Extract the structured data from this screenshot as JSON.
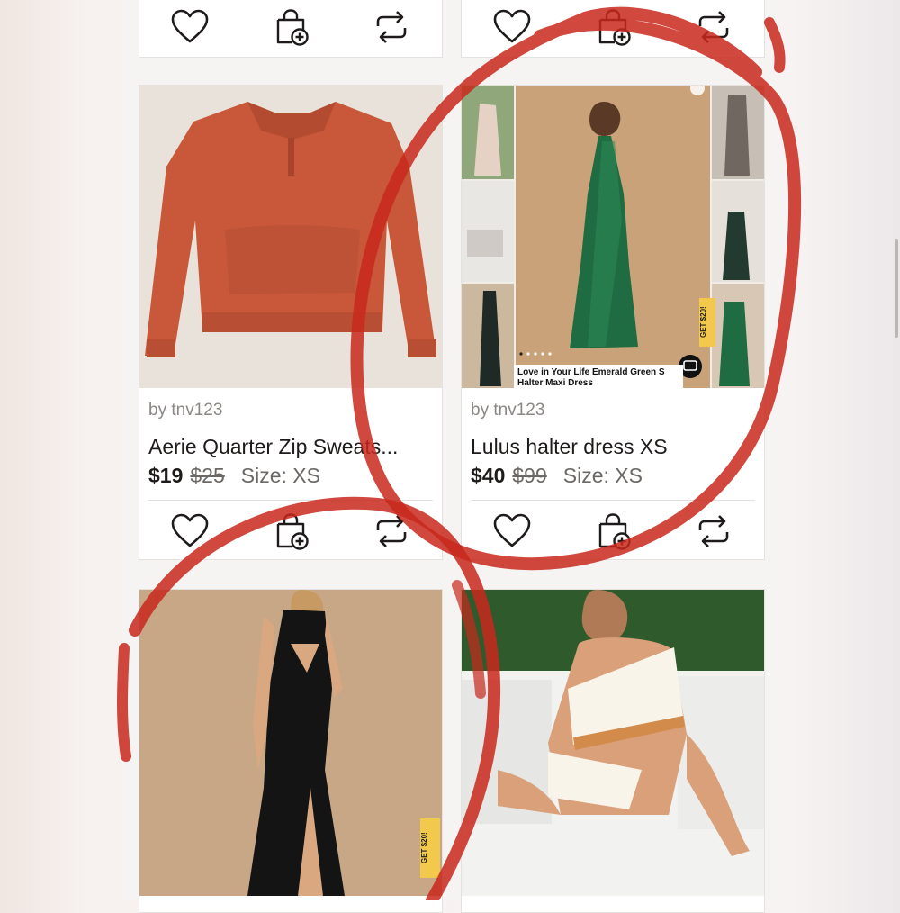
{
  "listings": [
    {
      "seller": "by tnv123",
      "title": "Aerie Quarter Zip Sweats...",
      "price": "$19",
      "original_price": "$25",
      "size": "Size: XS"
    },
    {
      "seller": "by tnv123",
      "title": "Lulus halter dress XS",
      "price": "$40",
      "original_price": "$99",
      "size": "Size: XS",
      "image_caption": "Love in Your Life Emerald Green S Halter Maxi Dress",
      "promo_tag": "GET $20!"
    }
  ],
  "bottom_left_promo_tag": "GET $20!",
  "icons": {
    "like": "heart-icon",
    "bundle": "shopping-bag-add-icon",
    "share": "repost-icon"
  },
  "colors": {
    "annotation": "#c8281c",
    "text_primary": "#1e1b1a",
    "text_secondary": "#8b8785"
  }
}
